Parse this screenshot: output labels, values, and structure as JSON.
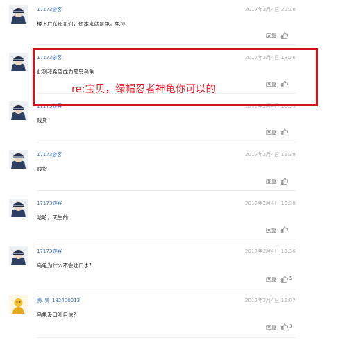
{
  "comments": [
    {
      "user": "17173游客",
      "date": "2017年2月4日 20:10",
      "text": "楼上广东那哥们，你本来就是龟，龟孙",
      "reply": "回复",
      "likes": ""
    },
    {
      "user": "17173游客",
      "date": "2017年2月4日 18:36",
      "text": "此刻我希望成为那只乌龟",
      "reply": "回复",
      "likes": ""
    },
    {
      "user": "17173游客",
      "date": "2017年2月4日 16:39",
      "text": "贱货",
      "reply": "回复",
      "likes": ""
    },
    {
      "user": "17173游客",
      "date": "2017年2月4日 16:39",
      "text": "贱货",
      "reply": "回复",
      "likes": ""
    },
    {
      "user": "17173游客",
      "date": "2017年2月4日 16:38",
      "text": "哈哈，天生的",
      "reply": "回复",
      "likes": ""
    },
    {
      "user": "17173游客",
      "date": "2017年2月4日 13:36",
      "text": "乌龟为什么不会吐口水？",
      "reply": "回复",
      "likes": "5"
    },
    {
      "user": "腾..赞_182400013",
      "date": "2017年2月4日 12:07",
      "text": "乌龟没口吐自沫？",
      "reply": "回复",
      "likes": "3"
    }
  ],
  "annotation": {
    "text": "re:宝贝，绿帽忍者神龟你可以的",
    "color": "#e0202a"
  },
  "colors": {
    "username": "#3a6fb5",
    "date": "#aaaaaa",
    "highlight_border": "#d4141c"
  },
  "icons": {
    "avatar": "ninja-avatar-icon",
    "avatar_alt": "gold-avatar-icon",
    "like": "thumbs-up-icon"
  }
}
